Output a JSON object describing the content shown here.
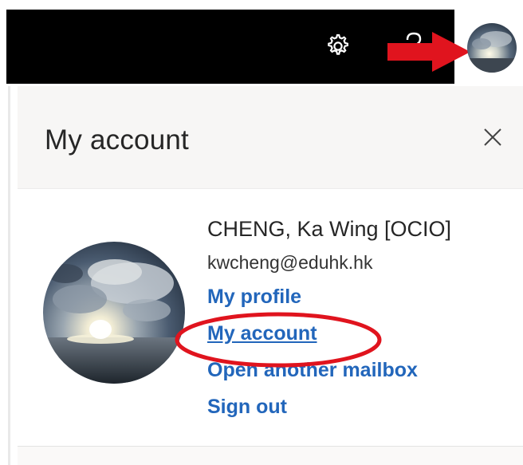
{
  "panel": {
    "title": "My account",
    "close_icon": "close-icon"
  },
  "user": {
    "name": "CHENG, Ka Wing [OCIO]",
    "email": "kwcheng@eduhk.hk"
  },
  "links": {
    "my_profile": "My profile",
    "my_account": "My account",
    "open_another_mailbox": "Open another mailbox",
    "sign_out": "Sign out"
  },
  "topbar": {
    "settings_icon": "gear-icon",
    "help_icon": "help-icon",
    "avatar_icon": "avatar"
  },
  "annotations": {
    "arrow_color": "#e0141e",
    "ellipse_color": "#e0141e"
  },
  "colors": {
    "link": "#2266bb",
    "topbar": "#000000",
    "header_bg": "#f7f6f5"
  }
}
